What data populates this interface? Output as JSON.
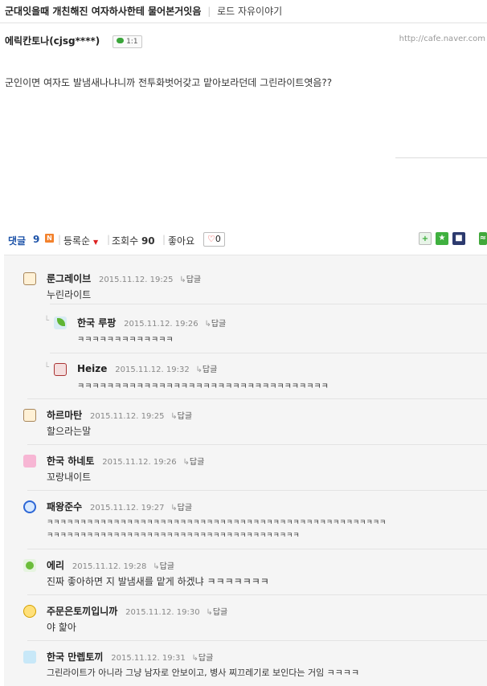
{
  "post": {
    "title": "군대잇을때 개친해진 여자하사한테 물어본거잇음",
    "board": "로드 자유이야기",
    "author": "에릭칸토나(cjsg****)",
    "badge": "1:1",
    "url": "http://cafe.naver.com",
    "body": "군인이면 여자도 발냄새나냐니까 전투화벗어갖고 맡아보라던데 그린라이트엿음??"
  },
  "comment_bar": {
    "label": "댓글",
    "count": "9",
    "new_badge": "N",
    "sort": "등록순",
    "views_label": "조회수",
    "views": "90",
    "likes_label": "좋아요",
    "like_count": "0"
  },
  "comments": [
    {
      "nick": "룬그레이브",
      "date": "2015.11.12. 19:25",
      "reply": "답글",
      "text": "누린라이트",
      "avatar": "glasses-avatar-icon"
    },
    {
      "nick": "한국 루팡",
      "date": "2015.11.12. 19:26",
      "reply": "답글",
      "text": "ㅋㅋㅋㅋㅋㅋㅋㅋㅋㅋㅋㅋㅋ",
      "avatar": "leaf-avatar-icon"
    },
    {
      "nick": "Heize",
      "date": "2015.11.12. 19:32",
      "reply": "답글",
      "text": "ㅋㅋㅋㅋㅋㅋㅋㅋㅋㅋㅋㅋㅋㅋㅋㅋㅋㅋㅋㅋㅋㅋㅋㅋㅋㅋㅋㅋㅋㅋㅋㅋㅋㅋ",
      "avatar": "face-avatar-icon"
    },
    {
      "nick": "하르마탄",
      "date": "2015.11.12. 19:25",
      "reply": "답글",
      "text": "할으라는말",
      "avatar": "glasses-avatar-icon"
    },
    {
      "nick": "한국 하네토",
      "date": "2015.11.12. 19:26",
      "reply": "답글",
      "text": "꼬랑내이트",
      "avatar": "pink-cat-avatar-icon"
    },
    {
      "nick": "패왕준수",
      "date": "2015.11.12. 19:27",
      "reply": "답글",
      "text": "ㅋㅋㅋㅋㅋㅋㅋㅋㅋㅋㅋㅋㅋㅋㅋㅋㅋㅋㅋㅋㅋㅋㅋㅋㅋㅋㅋㅋㅋㅋㅋㅋㅋㅋㅋㅋㅋㅋㅋㅋㅋㅋㅋㅋㅋㅋㅋㅋㅋㅋㅋ",
      "text2": "ㅋㅋㅋㅋㅋㅋㅋㅋㅋㅋㅋㅋㅋㅋㅋㅋㅋㅋㅋㅋㅋㅋㅋㅋㅋㅋㅋㅋㅋㅋㅋㅋㅋㅋㅋㅋㅋㅋ",
      "avatar": "blue-circle-avatar-icon"
    },
    {
      "nick": "에리",
      "date": "2015.11.12. 19:28",
      "reply": "답글",
      "text": "진짜 좋아하면 지 발냄새를 맡게 하겠냐 ㅋㅋㅋㅋㅋㅋㅋ",
      "avatar": "green-leaf-avatar-icon"
    },
    {
      "nick": "주문은토끼입니까",
      "date": "2015.11.12. 19:30",
      "reply": "답글",
      "text": "야 핥아",
      "avatar": "yellow-avatar-icon"
    },
    {
      "nick": "한국 만렙토끼",
      "date": "2015.11.12. 19:31",
      "reply": "답글",
      "text": "그린라이트가 아니라 그냥 남자로 안보이고, 병사 찌끄레기로 보인다는 거임 ㅋㅋㅋㅋ",
      "avatar": "sky-avatar-icon"
    }
  ]
}
